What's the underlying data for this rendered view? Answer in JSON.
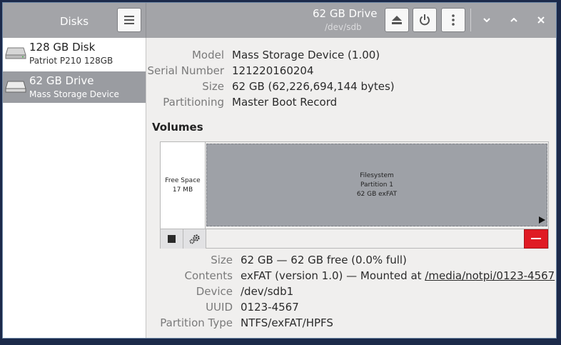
{
  "sidebar": {
    "title": "Disks",
    "disks": [
      {
        "name": "128 GB Disk",
        "model": "Patriot P210 128GB"
      },
      {
        "name": "62 GB Drive",
        "model": "Mass Storage Device"
      }
    ]
  },
  "header": {
    "title": "62 GB Drive",
    "subtitle": "/dev/sdb",
    "icons": [
      "menu-icon",
      "eject-icon",
      "power-icon",
      "kebab-menu-icon",
      "minimize-icon",
      "maximize-icon",
      "close-icon"
    ]
  },
  "drive": {
    "model_label": "Model",
    "model": "Mass Storage Device (1.00)",
    "serial_label": "Serial Number",
    "serial": "121220160204",
    "size_label": "Size",
    "size": "62 GB (62,226,694,144 bytes)",
    "partitioning_label": "Partitioning",
    "partitioning": "Master Boot Record"
  },
  "volumes": {
    "title": "Volumes",
    "free_space": {
      "label": "Free Space",
      "size": "17 MB"
    },
    "partition": {
      "line1": "Filesystem",
      "line2": "Partition 1",
      "line3": "62 GB exFAT"
    },
    "toolbar_icons": [
      "stop-icon",
      "settings-gear-icon",
      "delete-partition-icon"
    ]
  },
  "partition_details": {
    "size_label": "Size",
    "size": "62 GB — 62 GB free (0.0% full)",
    "contents_label": "Contents",
    "contents_prefix": "exFAT (version 1.0) — Mounted at ",
    "mount_link": "/media/notpi/0123-4567",
    "device_label": "Device",
    "device": "/dev/sdb1",
    "uuid_label": "UUID",
    "uuid": "0123-4567",
    "ptype_label": "Partition Type",
    "ptype": "NTFS/exFAT/HPFS"
  },
  "colors": {
    "header": "#a3a4a8",
    "selected_row": "#9a9ca1",
    "delete_button": "#e01b24",
    "partition_fill": "#9ea1a7"
  }
}
